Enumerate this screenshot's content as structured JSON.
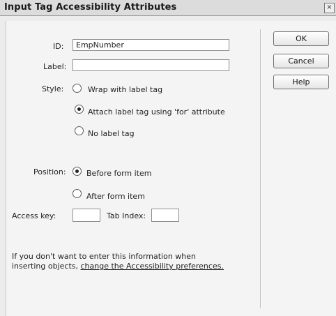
{
  "dialog": {
    "title": "Input Tag Accessibility Attributes",
    "close_glyph": "×"
  },
  "form": {
    "id_label": "ID:",
    "id_value": "EmpNumber",
    "label_label": "Label:",
    "label_value": "",
    "style_label": "Style:",
    "style_options": [
      {
        "label": "Wrap with label tag",
        "selected": false
      },
      {
        "label": "Attach label tag using 'for' attribute",
        "selected": true
      },
      {
        "label": "No label tag",
        "selected": false
      }
    ],
    "position_label": "Position:",
    "position_options": [
      {
        "label": "Before form item",
        "selected": true
      },
      {
        "label": "After form item",
        "selected": false
      }
    ],
    "access_key_label": "Access key:",
    "access_key_value": "",
    "tab_index_label": "Tab Index:",
    "tab_index_value": ""
  },
  "info": {
    "line1": "If you don't want to enter this information when",
    "line2_prefix": "inserting objects, ",
    "link_text": "change the Accessibility preferences."
  },
  "buttons": {
    "ok": "OK",
    "cancel": "Cancel",
    "help": "Help"
  }
}
